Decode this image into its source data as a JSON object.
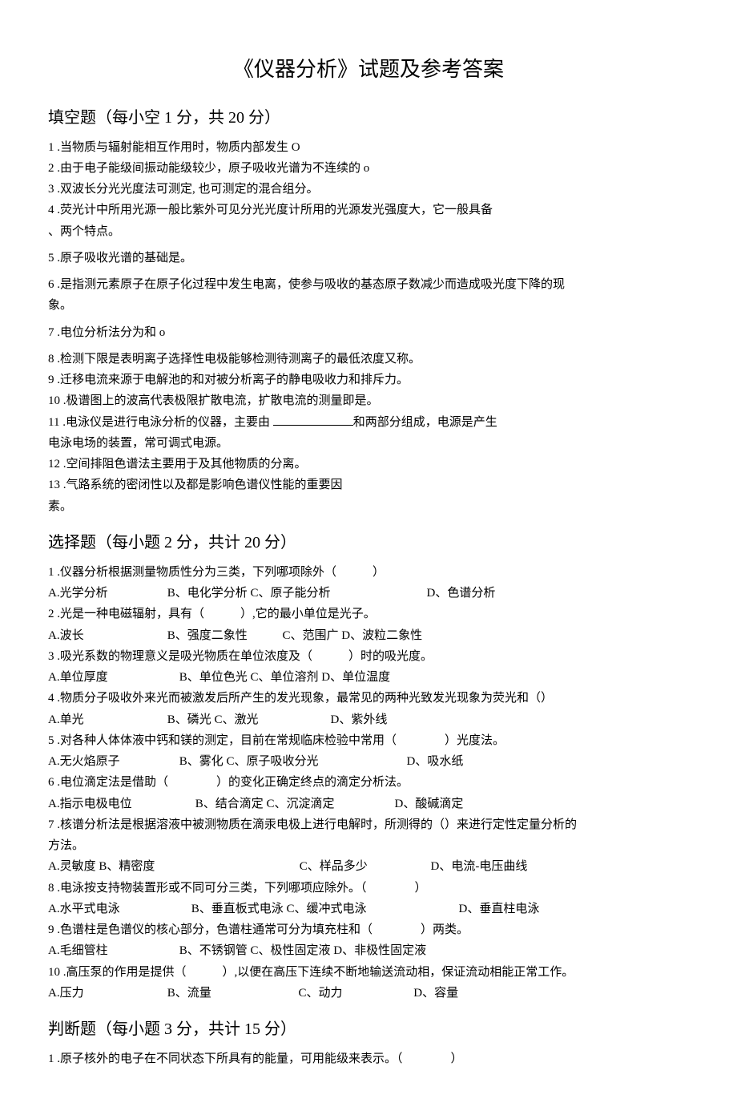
{
  "title": "《仪器分析》试题及参考答案",
  "sections": {
    "fill": {
      "header": "填空题（每小空 1 分，共 20 分）",
      "q1": "1 .当物质与辐射能相互作用时，物质内部发生 O",
      "q2": "2 .由于电子能级间振动能级较少，原子吸收光谱为不连续的 o",
      "q3": "3 .双波长分光光度法可测定, 也可测定的混合组分。",
      "q4a": "4 .荧光计中所用光源一般比紫外可见分光光度计所用的光源发光强度大，它一般具备",
      "q4b": "、两个特点。",
      "q5": "5 .原子吸收光谱的基础是。",
      "q6a": "6 .是指测元素原子在原子化过程中发生电离，使参与吸收的基态原子数减少而造成吸光度下降的现",
      "q6b": "象。",
      "q7": "7 .电位分析法分为和 o",
      "q8": "8 .检测下限是表明离子选择性电极能够检测待测离子的最低浓度又称。",
      "q9": "9 .迁移电流来源于电解池的和对被分析离子的静电吸收力和排斥力。",
      "q10": "10 .极谱图上的波高代表极限扩散电流，扩散电流的测量即是。",
      "q11a": "11 .电泳仪是进行电泳分析的仪器，主要由 ",
      "q11b": "和两部分组成，电源是产生",
      "q11c": "电泳电场的装置，常可调式电源。",
      "q12": "12 .空间排阻色谱法主要用于及其他物质的分离。",
      "q13a": "13 .气路系统的密闭性以及都是影响色谱仪性能的重要因",
      "q13b": "素。"
    },
    "choice": {
      "header": "选择题（每小题 2 分，共计 20 分）",
      "q1": "1 .仪器分析根据测量物质性分为三类，下列哪项除外（　　　）",
      "q1a": "A.光学分析",
      "q1b": "B、电化学分析 C、原子能分析",
      "q1d": "D、色谱分析",
      "q2": "2 .光是一种电磁辐射，具有（　　　）,它的最小单位是光子。",
      "q2a": "A.波长",
      "q2b": "B、强度二象性",
      "q2c": "C、范围广 D、波粒二象性",
      "q3": "3 .吸光系数的物理意义是吸光物质在单位浓度及（　　　）时的吸光度。",
      "q3a": "A.单位厚度",
      "q3b": "B、单位色光 C、单位溶剂 D、单位温度",
      "q4": "4 .物质分子吸收外来光而被激发后所产生的发光现象，最常见的两种光致发光现象为荧光和（）",
      "q4a": "A.单光",
      "q4b": "B、磷光 C、激光",
      "q4d": "D、紫外线",
      "q5": "5 .对各种人体体液中钙和镁的测定，目前在常规临床检验中常用（　　　　）光度法。",
      "q5a": "A.无火焰原子",
      "q5b": "B、雾化 C、原子吸收分光",
      "q5d": "D、吸水纸",
      "q6": "6 .电位滴定法是借助（　　　　）的变化正确定终点的滴定分析法。",
      "q6a": "A.指示电极电位",
      "q6b": "B、结合滴定 C、沉淀滴定",
      "q6d": "D、酸碱滴定",
      "q7a": "7 .核谱分析法是根据溶液中被测物质在滴汞电极上进行电解时，所测得的（）来进行定性定量分析的",
      "q7b": "方法。",
      "q7oa": "A.灵敏度 B、精密度",
      "q7oc": "C、样品多少",
      "q7od": "D、电流-电压曲线",
      "q8": "8 .电泳按支持物装置形或不同可分三类，下列哪项应除外。（　　　　）",
      "q8a": "A.水平式电泳",
      "q8b": "B、垂直板式电泳 C、缓冲式电泳",
      "q8d": "D、垂直柱电泳",
      "q9": "9 .色谱柱是色谱仪的核心部分，色谱柱通常可分为填充柱和（　　　　）两类。",
      "q9a": "A.毛细管柱",
      "q9b": "B、不锈钢管 C、极性固定液 D、非极性固定液",
      "q10": "10 .高压泵的作用是提供（　　　）,以便在高压下连续不断地输送流动相，保证流动相能正常工作。",
      "q10a": "A.压力",
      "q10b": "B、流量",
      "q10c": "C、动力",
      "q10d": "D、容量"
    },
    "judge": {
      "header": "判断题（每小题 3 分，共计 15 分）",
      "q1": "1 .原子核外的电子在不同状态下所具有的能量，可用能级来表示。（　　　　）"
    }
  }
}
